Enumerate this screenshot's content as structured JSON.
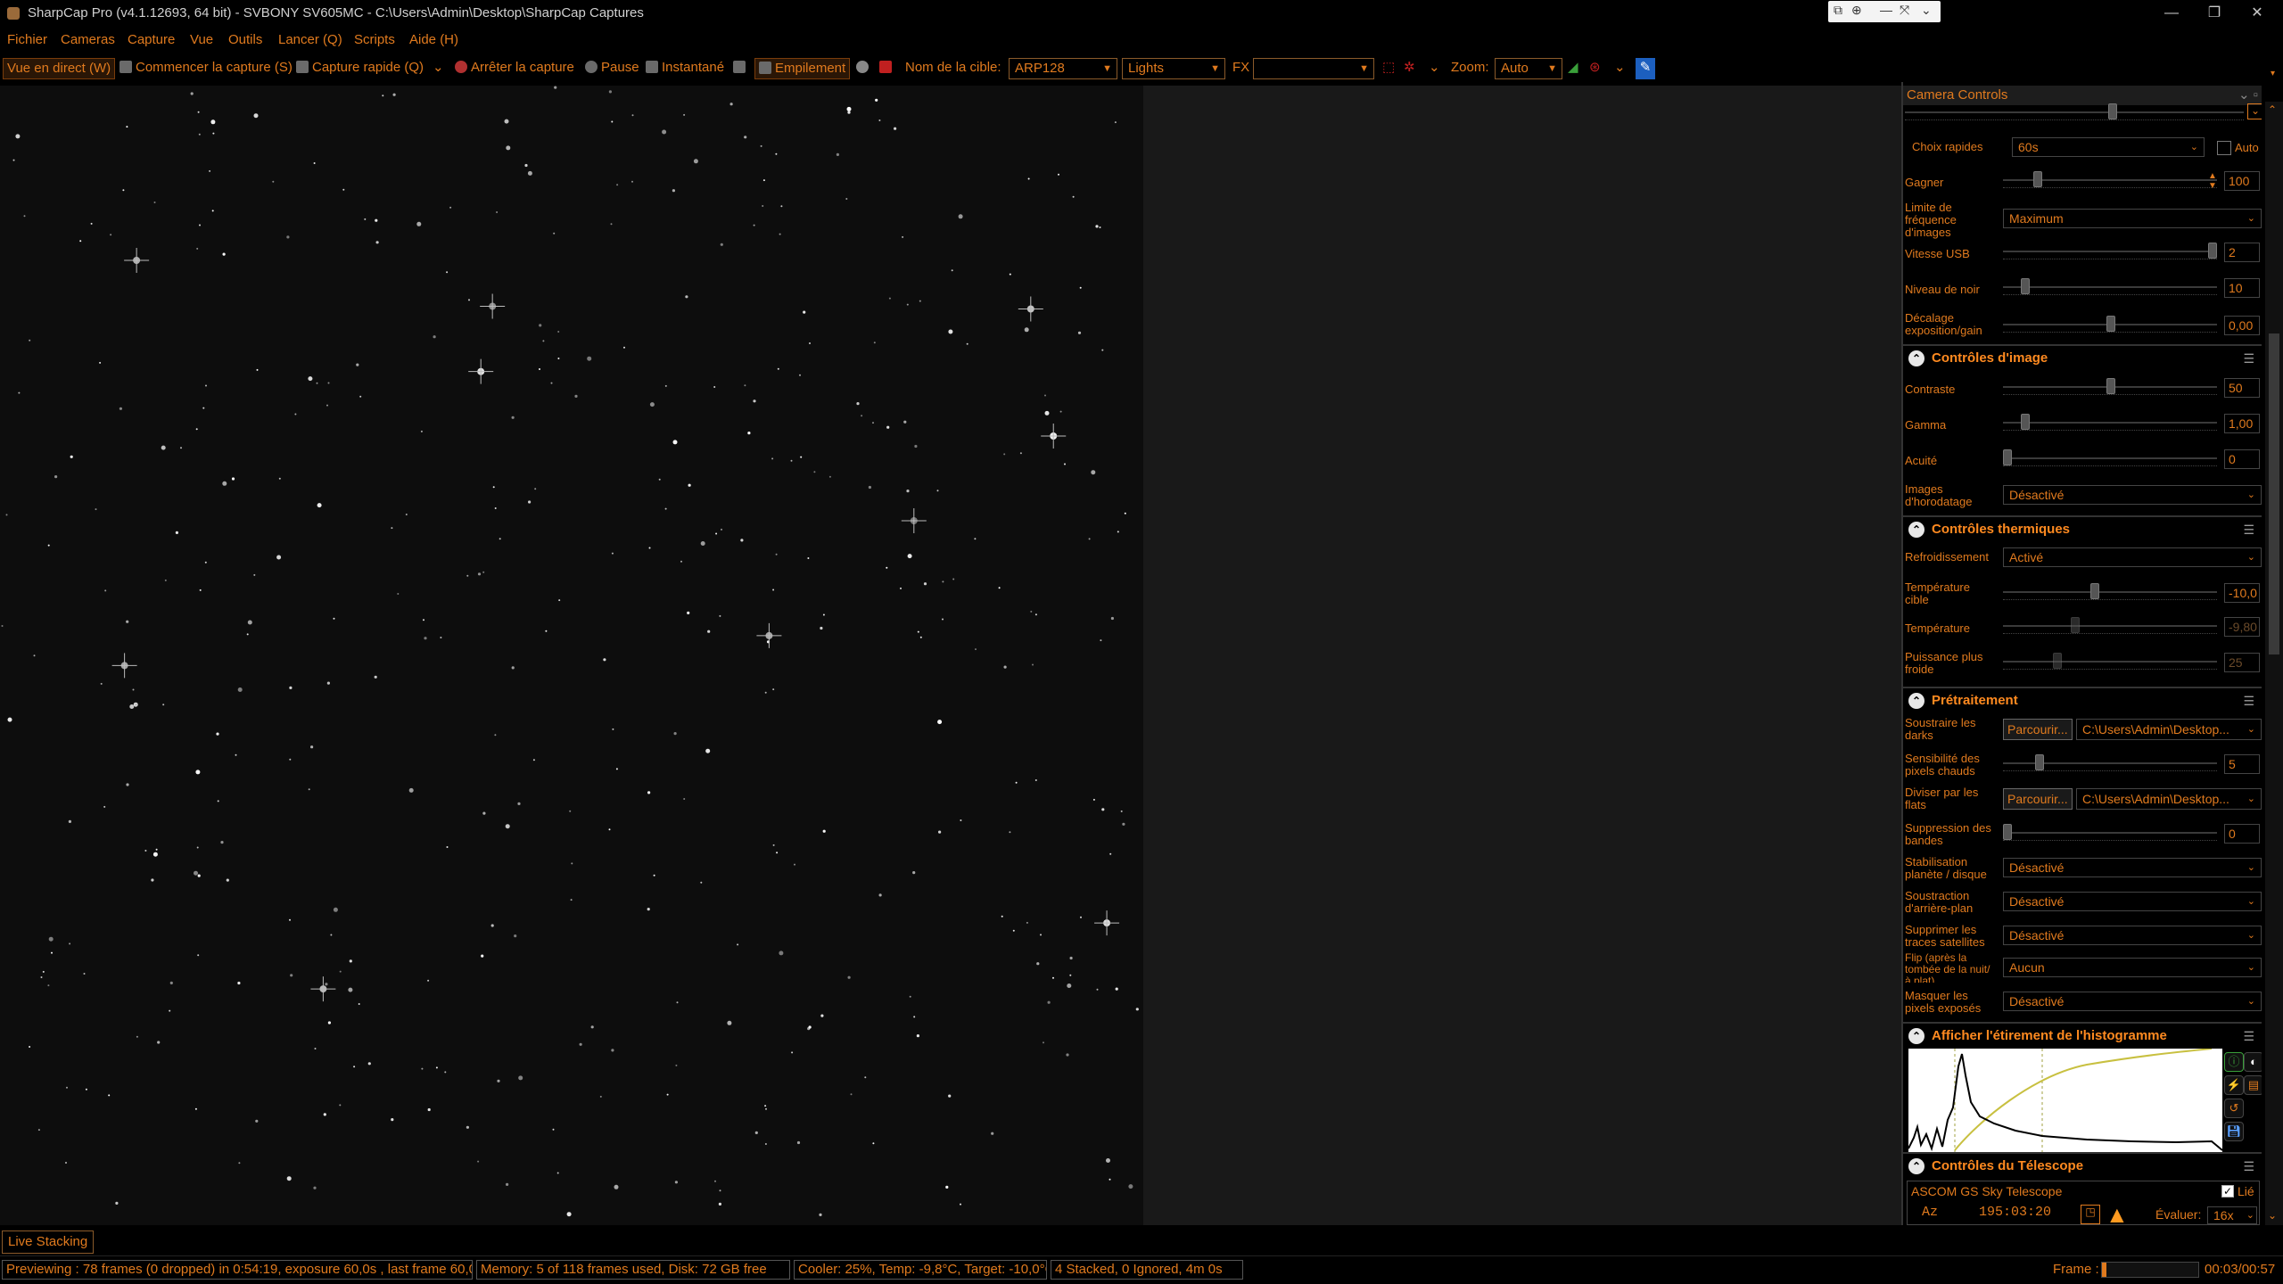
{
  "window": {
    "title": "SharpCap Pro (v4.1.12693, 64 bit) - SVBONY SV605MC - C:\\Users\\Admin\\Desktop\\SharpCap Captures",
    "minimize": "—",
    "maximize": "❐",
    "close": "✕"
  },
  "menu": [
    "Fichier",
    "Cameras",
    "Capture",
    "Vue",
    "Outils",
    "Lancer (Q)",
    "Scripts",
    "Aide (H)"
  ],
  "toolbar": {
    "live_view": "Vue en direct (W)",
    "start_capture": "Commencer la capture (S)",
    "quick_capture": "Capture rapide (Q)",
    "stop_capture": "Arrêter la capture",
    "pause": "Pause",
    "snapshot": "Instantané",
    "stacking": "Empilement",
    "target_label": "Nom de la cible:",
    "target_value": "ARP128",
    "frame_type": "Lights",
    "fx_label": "FX",
    "fx_value": "",
    "zoom_label": "Zoom:",
    "zoom_value": "Auto"
  },
  "live_stacking_tab": "Live Stacking",
  "panel": {
    "header": "Camera Controls",
    "camera": {
      "quick_choice_label": "Choix rapides",
      "quick_choice_value": "60s",
      "auto_label": "Auto",
      "gain_label": "Gagner",
      "gain_value": "100",
      "frame_rate_label": "Limite de fréquence d'images",
      "frame_rate_value": "Maximum",
      "usb_label": "Vitesse USB",
      "usb_value": "2",
      "black_label": "Niveau de noir",
      "black_value": "10",
      "offset_label": "Décalage exposition/gain",
      "offset_value": "0,00"
    },
    "image_controls": {
      "title": "Contrôles d'image",
      "contrast_label": "Contraste",
      "contrast_value": "50",
      "gamma_label": "Gamma",
      "gamma_value": "1,00",
      "sharpness_label": "Acuité",
      "sharpness_value": "0",
      "timestamp_label": "Images d'horodatage",
      "timestamp_value": "Désactivé"
    },
    "thermal": {
      "title": "Contrôles thermiques",
      "cooling_label": "Refroidissement",
      "cooling_value": "Activé",
      "target_temp_label": "Température cible",
      "target_temp_value": "-10,0",
      "temp_label": "Température",
      "temp_value": "-9,80",
      "power_label": "Puissance plus froide",
      "power_value": "25"
    },
    "preprocessing": {
      "title": "Prétraitement",
      "darks_label": "Soustraire les darks",
      "browse": "Parcourir...",
      "darks_path": "C:\\Users\\Admin\\Desktop...",
      "hot_pixel_label": "Sensibilité des pixels chauds",
      "hot_pixel_value": "5",
      "flats_label": "Diviser par les flats",
      "flats_path": "C:\\Users\\Admin\\Desktop...",
      "banding_label": "Suppression des bandes",
      "banding_value": "0",
      "stabilization_label": "Stabilisation planète / disque",
      "stabilization_value": "Désactivé",
      "background_label": "Soustraction d'arrière-plan",
      "background_value": "Désactivé",
      "satellite_label": "Supprimer les traces satellites",
      "satellite_value": "Désactivé",
      "flip_label": "Flip (après la tombée de la nuit/à plat)",
      "flip_value": "Aucun",
      "mask_label": "Masquer les pixels exposés",
      "mask_value": "Désactivé"
    },
    "histogram": {
      "title": "Afficher l'étirement de l'histogramme"
    },
    "telescope": {
      "title": "Contrôles du Télescope",
      "name": "ASCOM GS Sky Telescope",
      "linked_label": "Lié",
      "az_label": "Az",
      "az_value": "195:03:20",
      "rate_label": "Évaluer:",
      "rate_value": "16x"
    }
  },
  "status": {
    "preview": "Previewing : 78 frames (0 dropped) in 0:54:19, exposure 60,0s , last frame 60,0s",
    "memory": "Memory: 5 of 118 frames used, Disk: 72 GB free",
    "cooler": "Cooler: 25%, Temp: -9,8°C, Target: -10,0°C",
    "stacked": "4 Stacked, 0 Ignored, 4m 0s",
    "frame_label": "Frame :",
    "frame_progress": 0.05,
    "frame_time": "00:03/00:57"
  },
  "colors": {
    "accent": "#e07a1e",
    "background": "#000000",
    "image_bg": "#0d0d0d"
  }
}
